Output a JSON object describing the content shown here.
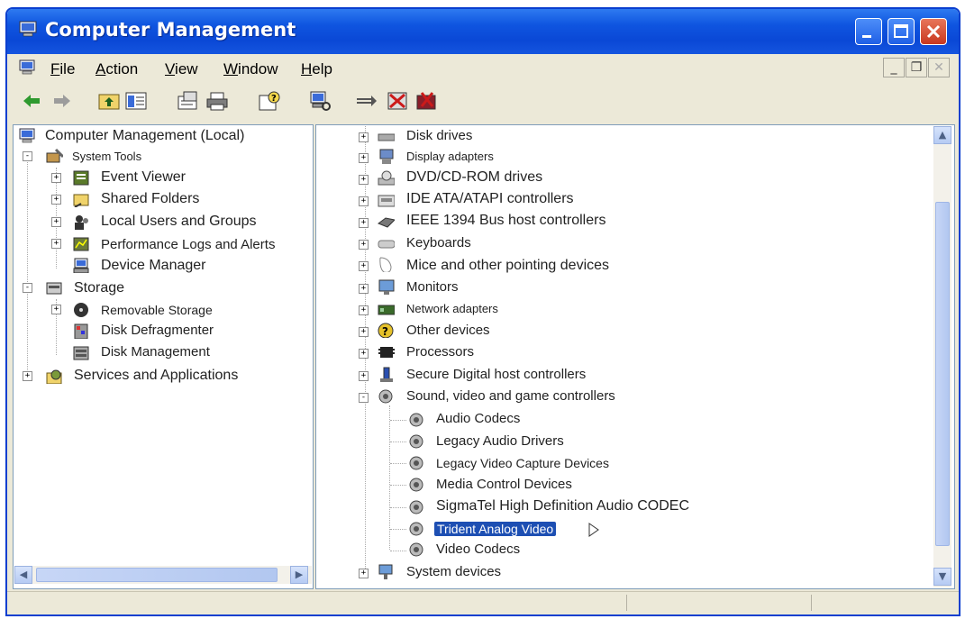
{
  "window": {
    "title": "Computer Management"
  },
  "menu": {
    "items": [
      "File",
      "Action",
      "View",
      "Window",
      "Help"
    ]
  },
  "toolbar": {
    "icons": [
      "back-arrow-icon",
      "forward-arrow-icon",
      "up-folder-icon",
      "show-hide-tree-icon",
      "properties-icon",
      "print-icon",
      "help-icon",
      "scan-hardware-icon",
      "update-driver-icon",
      "disable-device-icon",
      "uninstall-device-icon"
    ]
  },
  "left_tree": [
    {
      "label": "Computer Management (Local)"
    },
    {
      "label": "System Tools"
    },
    {
      "label": "Event Viewer"
    },
    {
      "label": "Shared Folders"
    },
    {
      "label": "Local Users and Groups"
    },
    {
      "label": "Performance Logs and Alerts"
    },
    {
      "label": "Device Manager"
    },
    {
      "label": "Storage"
    },
    {
      "label": "Removable Storage"
    },
    {
      "label": "Disk Defragmenter"
    },
    {
      "label": "Disk Management"
    },
    {
      "label": "Services and Applications"
    }
  ],
  "right_tree": [
    {
      "label": "Disk drives"
    },
    {
      "label": "Display adapters"
    },
    {
      "label": "DVD/CD-ROM drives"
    },
    {
      "label": "IDE ATA/ATAPI controllers"
    },
    {
      "label": "IEEE 1394 Bus host controllers"
    },
    {
      "label": "Keyboards"
    },
    {
      "label": "Mice and other pointing devices"
    },
    {
      "label": "Monitors"
    },
    {
      "label": "Network adapters"
    },
    {
      "label": "Other devices"
    },
    {
      "label": "Processors"
    },
    {
      "label": "Secure Digital host controllers"
    },
    {
      "label": "Sound, video and game controllers"
    },
    {
      "label": "Audio Codecs"
    },
    {
      "label": "Legacy Audio Drivers"
    },
    {
      "label": "Legacy Video Capture Devices"
    },
    {
      "label": "Media Control Devices"
    },
    {
      "label": "SigmaTel High Definition Audio CODEC"
    },
    {
      "label": "Trident Analog Video"
    },
    {
      "label": "Video Codecs"
    },
    {
      "label": "System devices"
    }
  ],
  "colors": {
    "titlebar": "#0a48d6",
    "selection": "#1d4fb3",
    "chrome": "#ece9d8"
  }
}
